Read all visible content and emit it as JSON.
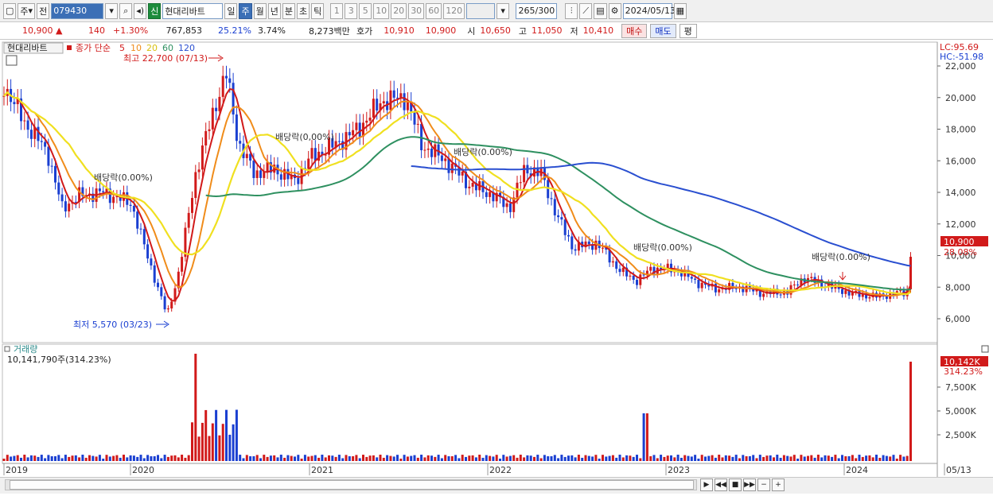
{
  "toolbar": {
    "market": "주",
    "prev": "전",
    "code": "079430",
    "badge": "신",
    "stock_name": "현대리바트",
    "periods": [
      "일",
      "주",
      "월",
      "년",
      "분",
      "초",
      "틱"
    ],
    "active_period": "주",
    "intervals": [
      "1",
      "3",
      "5",
      "10",
      "20",
      "30",
      "60",
      "120"
    ],
    "count": "265",
    "count_total": "/300",
    "date": "2024/05/13"
  },
  "info": {
    "price": "10,900",
    "change": "140",
    "change_pct": "+1.30%",
    "volume": "767,853",
    "turnover": "25.21%",
    "ratio": "3.74%",
    "amount": "8,273백만",
    "ask_label": "호가",
    "ask1": "10,910",
    "ask2": "10,900",
    "open_label": "시",
    "open": "10,650",
    "high_label": "고",
    "high": "11,050",
    "low_label": "저",
    "low": "10,410",
    "buy": "매수",
    "sell": "매도",
    "flat": "평"
  },
  "legend": {
    "name": "현대리바트",
    "ma_label": "종가 단순",
    "ma_periods": [
      "5",
      "10",
      "20",
      "60",
      "120"
    ],
    "ma_colors": [
      "#d11a1a",
      "#f08c1a",
      "#f0e020",
      "#2e9060",
      "#2a4fd0"
    ]
  },
  "annotations": {
    "high": "최고 22,700 (07/13)",
    "low": "최저 5,570 (03/23)",
    "dividend": "배당락(0.00%)",
    "dividend_2": "배당락(0,00%)"
  },
  "right_axis": {
    "lc": "LC:95.69",
    "hc": "HC:-51.98",
    "price_ticks": [
      "22,000",
      "20,000",
      "18,000",
      "16,000",
      "14,000",
      "12,000",
      "10,000",
      "8,000",
      "6,000"
    ],
    "price_tag": "10,900",
    "price_tag_pct": "28.08%",
    "volume_ticks": [
      "7,500K",
      "5,000K",
      "2,500K"
    ],
    "volume_tag": "10,142K",
    "volume_tag_pct": "314.23%"
  },
  "volume_panel": {
    "title": "거래량",
    "value": "10,141,790주(314.23%)"
  },
  "x_axis": [
    "2019",
    "2020",
    "2021",
    "2022",
    "2023",
    "2024",
    "05/13"
  ],
  "colors": {
    "up": "#d11a1a",
    "down": "#1a3fd1",
    "accent": "#3b6fb6"
  }
}
